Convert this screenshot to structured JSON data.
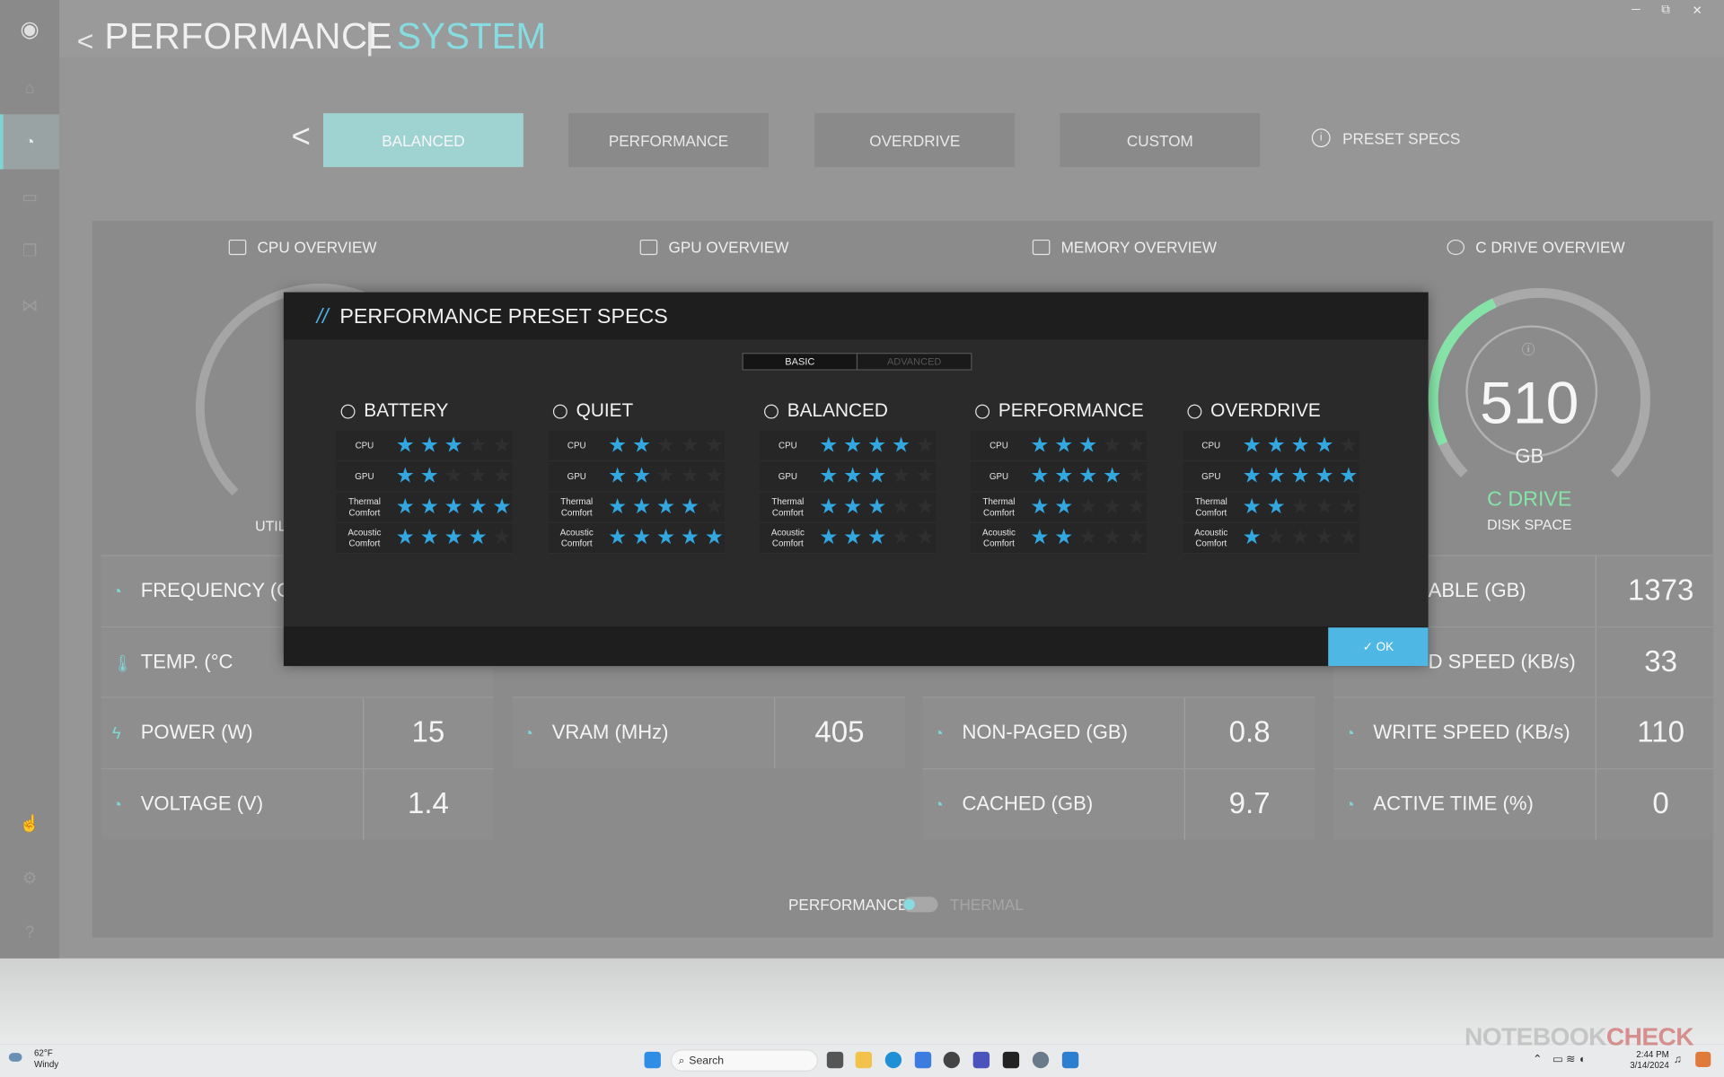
{
  "header": {
    "back_glyph": "<",
    "title": "PERFORMANCE",
    "separator": "|",
    "subtitle": "SYSTEM"
  },
  "presets": {
    "prev_glyph": "<",
    "buttons": [
      "BALANCED",
      "PERFORMANCE",
      "OVERDRIVE",
      "CUSTOM"
    ],
    "active": "BALANCED",
    "specs_label": "PRESET SPECS",
    "specs_icon": "info-icon"
  },
  "overview": {
    "titles": [
      "CPU OVERVIEW",
      "GPU OVERVIEW",
      "MEMORY OVERVIEW",
      "C DRIVE OVERVIEW"
    ],
    "cpu_gauge_label_partial": "UTIL",
    "drive": {
      "value": "510",
      "unit": "GB",
      "name": "C DRIVE",
      "sub": "DISK SPACE"
    }
  },
  "metrics": {
    "cpu": [
      {
        "label": "FREQUENCY (GI",
        "value": ""
      },
      {
        "label": "TEMP. (°C",
        "value": ""
      },
      {
        "label": "POWER (W)",
        "value": "15"
      },
      {
        "label": "VOLTAGE (V)",
        "value": "1.4"
      }
    ],
    "gpu": [
      {
        "label": "VRAM (MHz)",
        "value": "405"
      }
    ],
    "memory": [
      {
        "label": "NON-PAGED (GB)",
        "value": "0.8"
      },
      {
        "label": "CACHED (GB)",
        "value": "9.7"
      }
    ],
    "drive": [
      {
        "label": "ABLE (GB)",
        "value": "1373"
      },
      {
        "label": "D SPEED (KB/s)",
        "value": "33"
      },
      {
        "label": "WRITE SPEED (KB/s)",
        "value": "110"
      },
      {
        "label": "ACTIVE TIME (%)",
        "value": "0"
      }
    ]
  },
  "bottom_toggle": {
    "left": "PERFORMANCE",
    "right": "THERMAL",
    "state": "PERFORMANCE"
  },
  "dialog": {
    "slash": "//",
    "title": "PERFORMANCE PRESET SPECS",
    "tabs": [
      "BASIC",
      "ADVANCED"
    ],
    "active_tab": "BASIC",
    "ok_label": "✓ OK",
    "rows": [
      {
        "line1": "CPU",
        "line2": ""
      },
      {
        "line1": "GPU",
        "line2": ""
      },
      {
        "line1": "Thermal",
        "line2": "Comfort"
      },
      {
        "line1": "Acoustic",
        "line2": "Comfort"
      }
    ],
    "max_stars": 5,
    "modes": [
      {
        "name": "BATTERY",
        "icon": "battery-icon",
        "ratings": [
          3,
          2,
          5,
          4
        ]
      },
      {
        "name": "QUIET",
        "icon": "fan-icon",
        "ratings": [
          2,
          2,
          4,
          5
        ]
      },
      {
        "name": "BALANCED",
        "icon": "balance-gauge-icon",
        "ratings": [
          4,
          3,
          3,
          3
        ]
      },
      {
        "name": "PERFORMANCE",
        "icon": "speed-gauge-icon",
        "ratings": [
          3,
          4,
          2,
          2
        ]
      },
      {
        "name": "OVERDRIVE",
        "icon": "overdrive-gauge-icon",
        "ratings": [
          4,
          5,
          2,
          1
        ]
      }
    ]
  },
  "taskbar": {
    "weather_temp": "62°F",
    "weather_text": "Windy",
    "search_label": "Search",
    "time": "2:44 PM",
    "date": "3/14/2024"
  },
  "watermark": {
    "text": "NOTEBOOK",
    "accent": "CHECK"
  },
  "colors": {
    "accent_teal": "#86dce0",
    "star_blue": "#33a7e0",
    "drive_green": "#86e3a8",
    "ok_blue": "#4fb7e3"
  }
}
